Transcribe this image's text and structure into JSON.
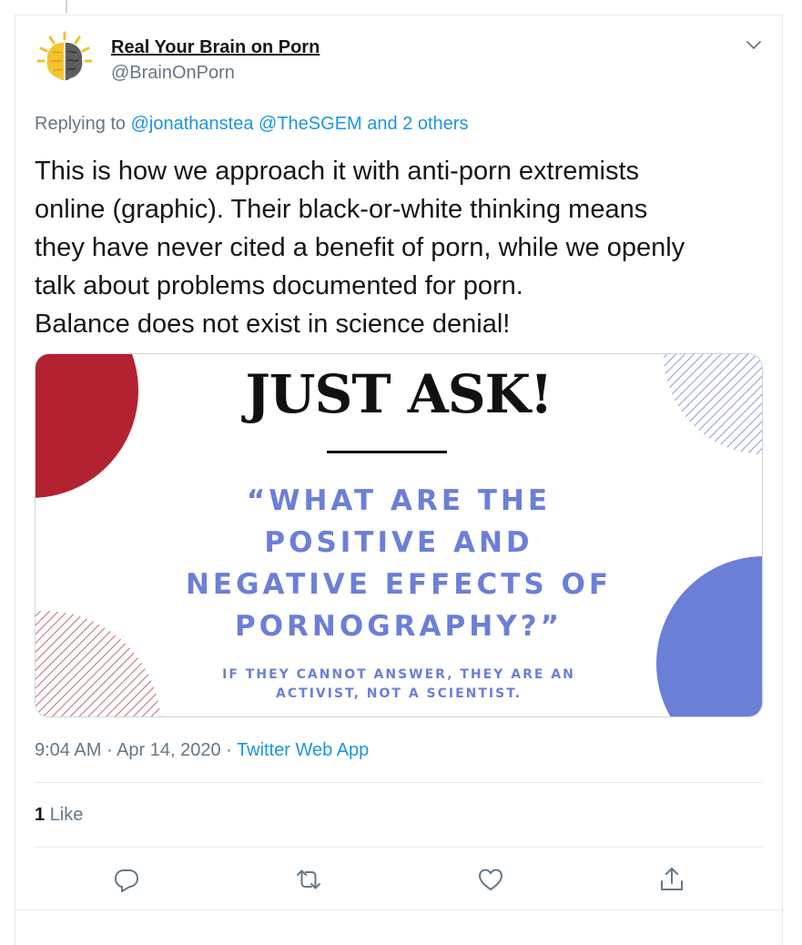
{
  "author": {
    "name": "Real Your Brain on Porn",
    "handle": "@BrainOnPorn",
    "avatar_icon": "brain-logo-icon"
  },
  "replying": {
    "prefix": "Replying to",
    "mention_1": "@jonathanstea",
    "mention_2": "@TheSGEM",
    "others": "and 2 others"
  },
  "tweet_text": {
    "line_1": "This is how we approach it with anti-porn extremists",
    "line_2": "online (graphic). Their black-or-white thinking means",
    "line_3": "they have never cited a benefit of porn, while we openly",
    "line_4": "talk about problems documented for porn.",
    "line_5": "Balance does not exist in science denial!"
  },
  "media": {
    "headline": "JUST ASK!",
    "question_lines": [
      "“WHAT ARE THE",
      "POSITIVE AND",
      "NEGATIVE EFFECTS OF",
      "PORNOGRAPHY?”"
    ],
    "note_lines": [
      "IF THEY CANNOT ANSWER, THEY ARE AN",
      "ACTIVIST, NOT A SCIENTIST."
    ],
    "colors": {
      "red": "#b22231",
      "blue": "#6b7fd7",
      "text": "#111111"
    }
  },
  "meta": {
    "time": "9:04 AM",
    "separator": "·",
    "date": "Apr 14, 2020",
    "source": "Twitter Web App"
  },
  "likes": {
    "count": "1",
    "label": "Like"
  },
  "actions": [
    "reply-icon",
    "retweet-icon",
    "like-icon",
    "share-icon"
  ],
  "colors": {
    "link": "#1b95e0",
    "secondary_text": "#657786",
    "border": "#e6ecf0"
  }
}
